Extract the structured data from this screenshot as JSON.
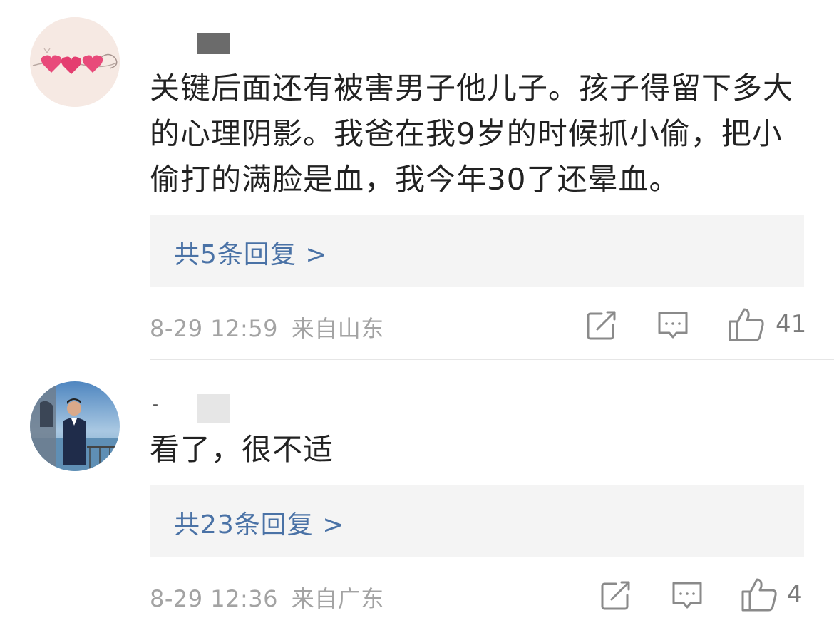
{
  "comments": [
    {
      "text": "关键后面还有被害男子他儿子。孩子得留下多大的心理阴影。我爸在我9岁的时候抓小偷，把小偷打的满脸是血，我今年30了还晕血。",
      "replies_label": "共5条回复 >",
      "date": "8-29 12:59",
      "location": "来自山东",
      "likes": "41"
    },
    {
      "name_prefix": "-",
      "text": "看了，很不适",
      "replies_label": "共23条回复 >",
      "date": "8-29 12:36",
      "location": "来自广东",
      "likes": "4"
    }
  ],
  "icons": {
    "share": "share-icon",
    "comment": "comment-icon",
    "like": "thumbs-up-icon"
  },
  "colors": {
    "link": "#4a72a6",
    "meta": "#a3a3a3",
    "reply_bg": "#f4f4f4"
  }
}
